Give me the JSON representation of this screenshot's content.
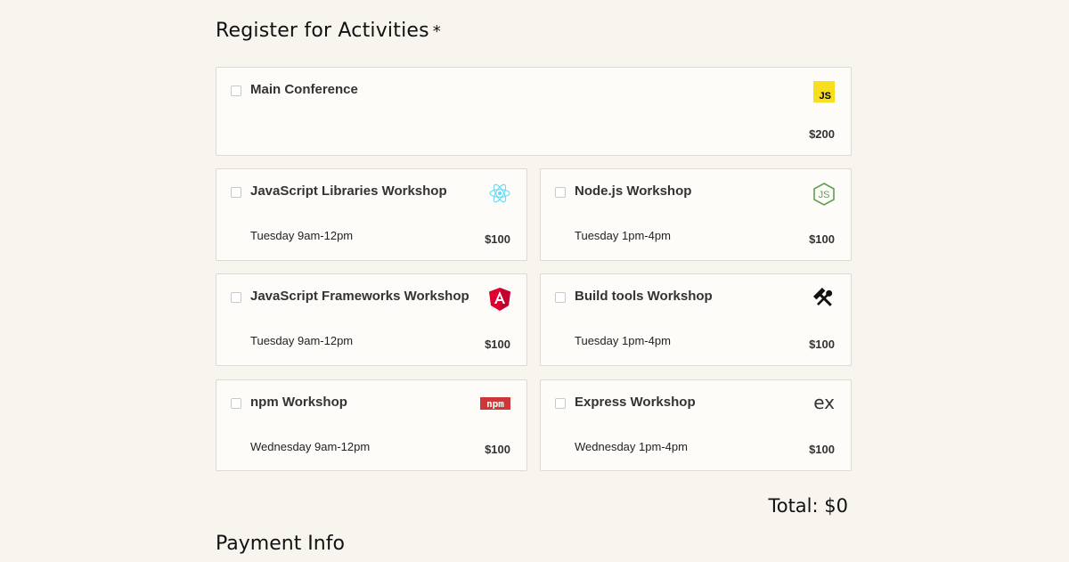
{
  "heading": "Register for Activities",
  "required_mark": "*",
  "activities": [
    {
      "title": "Main Conference",
      "time": "",
      "price": "$200",
      "icon": "javascript-logo-icon"
    },
    {
      "title": "JavaScript Libraries Workshop",
      "time": "Tuesday 9am-12pm",
      "price": "$100",
      "icon": "react-logo-icon"
    },
    {
      "title": "Node.js Workshop",
      "time": "Tuesday 1pm-4pm",
      "price": "$100",
      "icon": "nodejs-logo-icon"
    },
    {
      "title": "JavaScript Frameworks Workshop",
      "time": "Tuesday 9am-12pm",
      "price": "$100",
      "icon": "angular-logo-icon"
    },
    {
      "title": "Build tools Workshop",
      "time": "Tuesday 1pm-4pm",
      "price": "$100",
      "icon": "build-tools-icon"
    },
    {
      "title": "npm Workshop",
      "time": "Wednesday 9am-12pm",
      "price": "$100",
      "icon": "npm-logo-icon"
    },
    {
      "title": "Express Workshop",
      "time": "Wednesday 1pm-4pm",
      "price": "$100",
      "icon": "express-logo-icon"
    }
  ],
  "logo_text": {
    "js": "JS",
    "npm": "npm",
    "express": "ex"
  },
  "total_text": "Total: $0",
  "next_section": "Payment Info",
  "colors": {
    "js": "#f7df1e",
    "react": "#61dafb",
    "node": "#5fa04e",
    "angular": "#dd0031",
    "npm": "#cb3837"
  }
}
